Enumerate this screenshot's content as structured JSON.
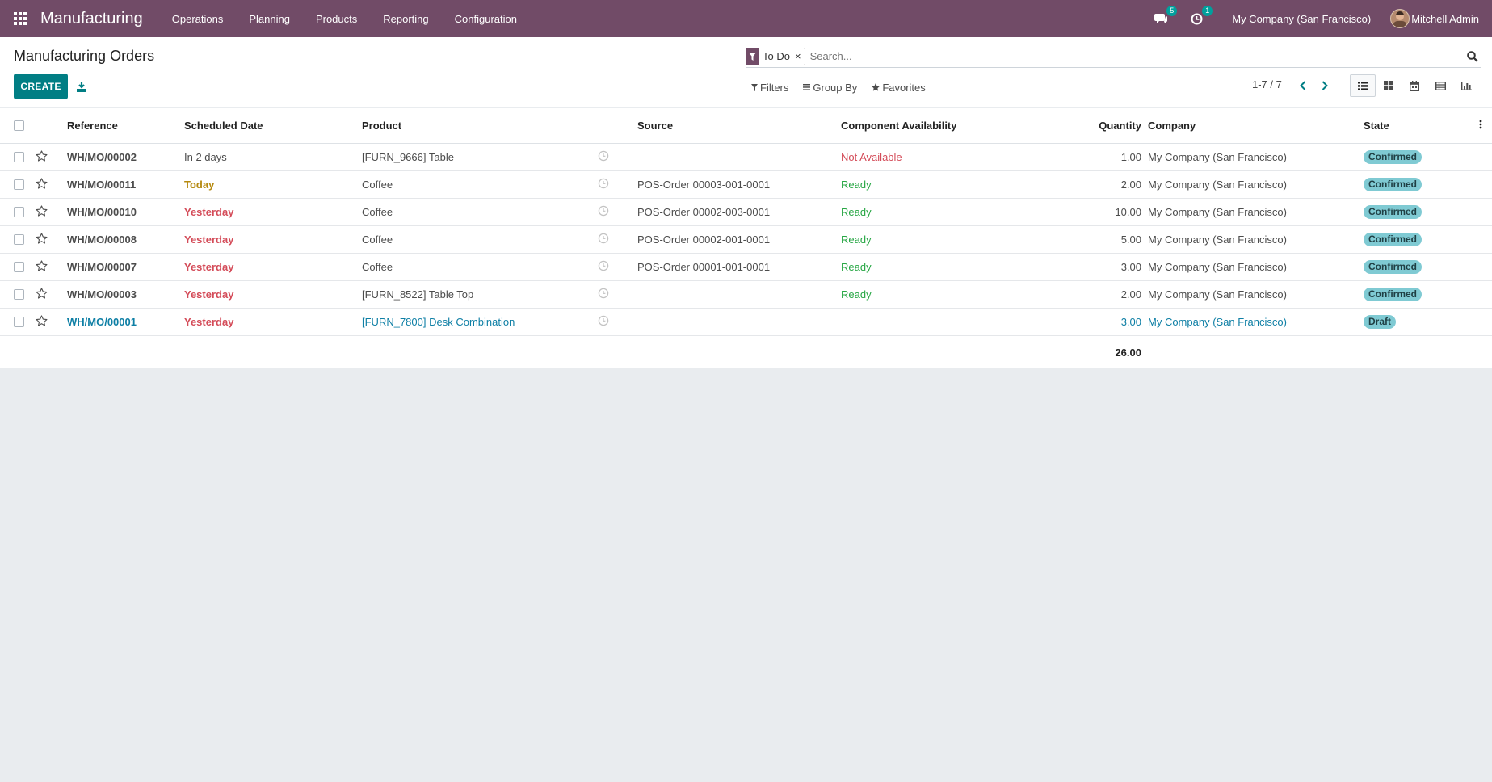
{
  "navbar": {
    "brand": "Manufacturing",
    "menu": [
      "Operations",
      "Planning",
      "Products",
      "Reporting",
      "Configuration"
    ],
    "messages_count": "5",
    "activities_count": "1",
    "company": "My Company (San Francisco)",
    "user": "Mitchell Admin",
    "accent_color": "#714b67"
  },
  "control": {
    "title": "Manufacturing Orders",
    "create_label": "CREATE",
    "facet_label": "To Do",
    "facet_remove": "×",
    "search_placeholder": "Search...",
    "filters_label": "Filters",
    "groupby_label": "Group By",
    "favorites_label": "Favorites",
    "pager": "1-7 / 7"
  },
  "table": {
    "columns": [
      "Reference",
      "Scheduled Date",
      "Product",
      "Source",
      "Component Availability",
      "Quantity",
      "Company",
      "State"
    ],
    "rows": [
      {
        "ref": "WH/MO/00002",
        "date": "In 2 days",
        "date_status": "future",
        "product": "[FURN_9666] Table",
        "source": "",
        "availability": "Not Available",
        "avail_status": "no",
        "qty": "1.00",
        "company": "My Company (San Francisco)",
        "state": "Confirmed"
      },
      {
        "ref": "WH/MO/00011",
        "date": "Today",
        "date_status": "today",
        "product": "Coffee",
        "source": "POS-Order 00003-001-0001",
        "availability": "Ready",
        "avail_status": "ok",
        "qty": "2.00",
        "company": "My Company (San Francisco)",
        "state": "Confirmed"
      },
      {
        "ref": "WH/MO/00010",
        "date": "Yesterday",
        "date_status": "late",
        "product": "Coffee",
        "source": "POS-Order 00002-003-0001",
        "availability": "Ready",
        "avail_status": "ok",
        "qty": "10.00",
        "company": "My Company (San Francisco)",
        "state": "Confirmed"
      },
      {
        "ref": "WH/MO/00008",
        "date": "Yesterday",
        "date_status": "late",
        "product": "Coffee",
        "source": "POS-Order 00002-001-0001",
        "availability": "Ready",
        "avail_status": "ok",
        "qty": "5.00",
        "company": "My Company (San Francisco)",
        "state": "Confirmed"
      },
      {
        "ref": "WH/MO/00007",
        "date": "Yesterday",
        "date_status": "late",
        "product": "Coffee",
        "source": "POS-Order 00001-001-0001",
        "availability": "Ready",
        "avail_status": "ok",
        "qty": "3.00",
        "company": "My Company (San Francisco)",
        "state": "Confirmed"
      },
      {
        "ref": "WH/MO/00003",
        "date": "Yesterday",
        "date_status": "late",
        "product": "[FURN_8522] Table Top",
        "source": "",
        "availability": "Ready",
        "avail_status": "ok",
        "qty": "2.00",
        "company": "My Company (San Francisco)",
        "state": "Confirmed"
      },
      {
        "ref": "WH/MO/00001",
        "date": "Yesterday",
        "date_status": "late",
        "product": "[FURN_7800] Desk Combination",
        "source": "",
        "availability": "",
        "avail_status": "",
        "qty": "3.00",
        "company": "My Company (San Francisco)",
        "state": "Draft"
      }
    ],
    "total_qty": "26.00"
  }
}
